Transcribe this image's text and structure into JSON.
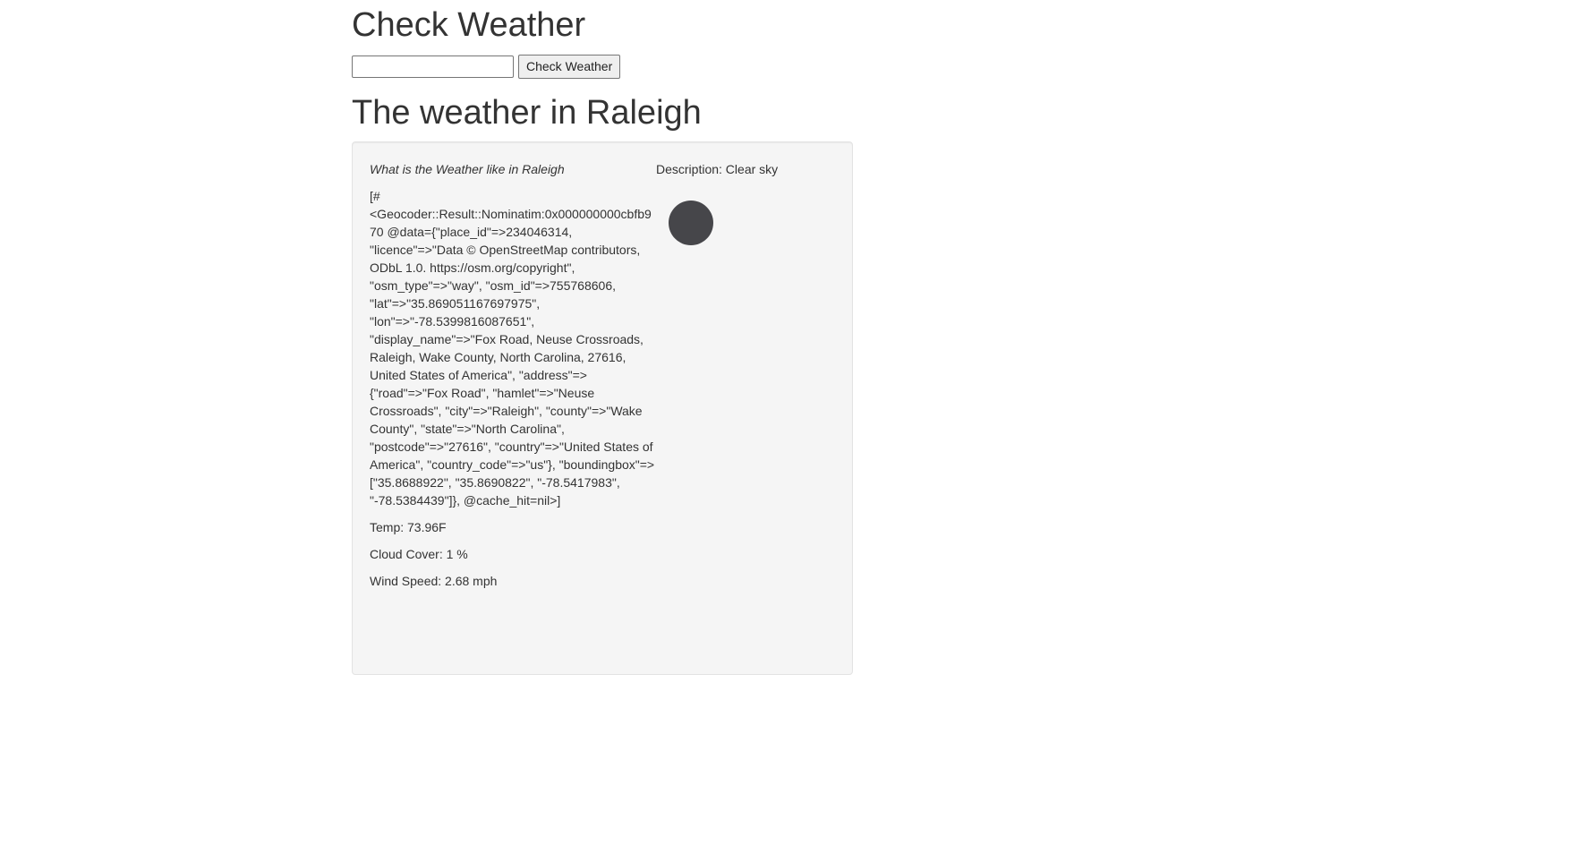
{
  "page": {
    "title": "Check Weather"
  },
  "search": {
    "value": "",
    "placeholder": "",
    "button_label": "Check Weather"
  },
  "result": {
    "heading": "The weather in Raleigh",
    "question": "What is the Weather like in Raleigh",
    "description": "Description: Clear sky",
    "icon": "clear-sky-icon",
    "geocoder_raw": "[#<Geocoder::Result::Nominatim:0x000000000cbfb970 @data={\"place_id\"=>234046314, \"licence\"=>\"Data © OpenStreetMap contributors, ODbL 1.0. https://osm.org/copyright\", \"osm_type\"=>\"way\", \"osm_id\"=>755768606, \"lat\"=>\"35.869051167697975\", \"lon\"=>\"-78.5399816087651\", \"display_name\"=>\"Fox Road, Neuse Crossroads, Raleigh, Wake County, North Carolina, 27616, United States of America\", \"address\"=>{\"road\"=>\"Fox Road\", \"hamlet\"=>\"Neuse Crossroads\", \"city\"=>\"Raleigh\", \"county\"=>\"Wake County\", \"state\"=>\"North Carolina\", \"postcode\"=>\"27616\", \"country\"=>\"United States of America\", \"country_code\"=>\"us\"}, \"boundingbox\"=>[\"35.8688922\", \"35.8690822\", \"-78.5417983\", \"-78.5384439\"]}, @cache_hit=nil>]",
    "temp": "Temp: 73.96F",
    "cloud_cover": "Cloud Cover: 1 %",
    "wind_speed": "Wind Speed: 2.68 mph"
  },
  "colors": {
    "well_background": "#f5f5f5",
    "icon_fill": "#46464a",
    "text": "#333333"
  }
}
